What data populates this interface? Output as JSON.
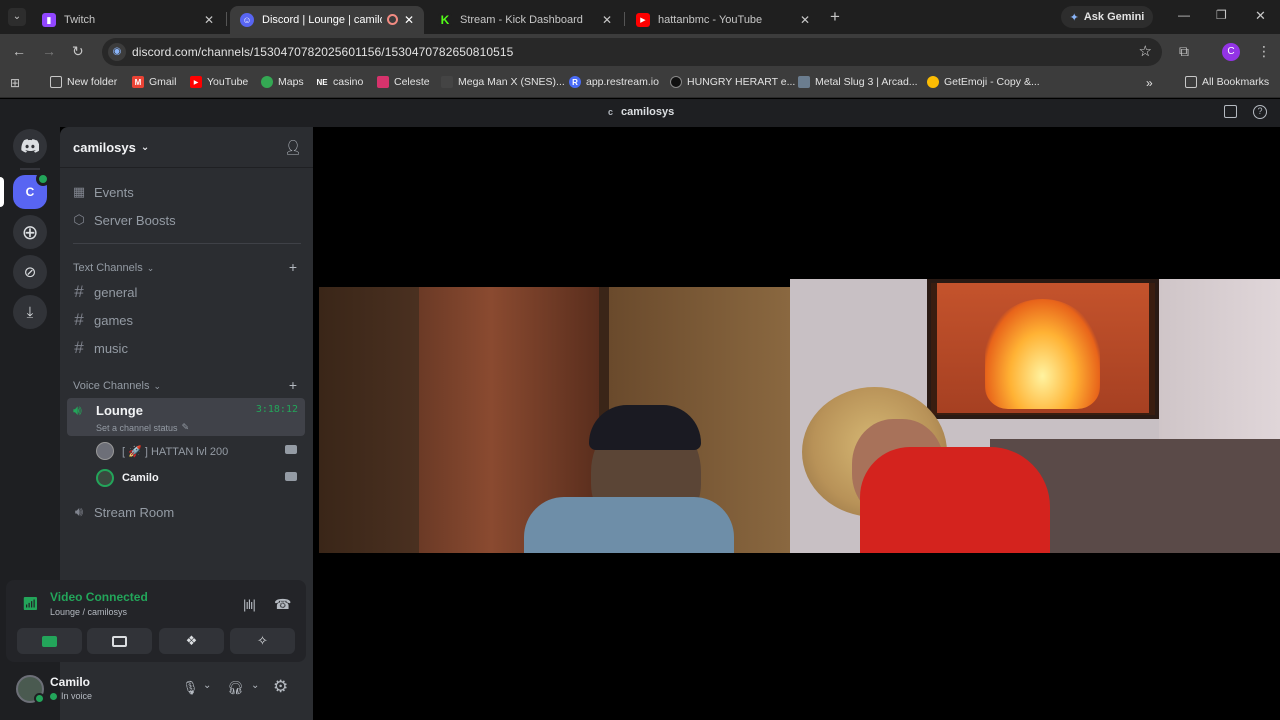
{
  "browser": {
    "tabs": [
      {
        "label": "Twitch",
        "favicon": "twitch-icon"
      },
      {
        "label": "Discord | Lounge | camilosy",
        "favicon": "discord-icon"
      },
      {
        "label": "Stream - Kick Dashboard",
        "favicon": "kick-icon"
      },
      {
        "label": "hattanbmc - YouTube",
        "favicon": "youtube-icon"
      }
    ],
    "ask_gemini": "Ask Gemini",
    "url": "discord.com/channels/1530470782025601156/1530470782650810515",
    "profile_initial": "C",
    "bookmarks": [
      "New folder",
      "Gmail",
      "YouTube",
      "Maps",
      "casino",
      "Celeste",
      "Mega Man X (SNES)...",
      "app.restream.io",
      "HUNGRY HERART e...",
      "Metal Slug 3 | Arcad...",
      "GetEmoji - Copy &..."
    ],
    "all_bookmarks": "All Bookmarks",
    "bookmark_icon_letters": {
      "casino": "NE",
      "restream": "R"
    }
  },
  "discord": {
    "window_title": "camilosys",
    "window_title_icon": "c",
    "server_initial": "C",
    "server_name": "camilosys",
    "menu": [
      "Events",
      "Server Boosts"
    ],
    "text_category": "Text Channels",
    "text_channels": [
      "general",
      "games",
      "music"
    ],
    "voice_category": "Voice Channels",
    "voice_channel": {
      "name": "Lounge",
      "timer": "3:18:12",
      "status_placeholder": "Set a channel status",
      "members": [
        "[ 🚀 ] HATTAN lvl 200",
        "Camilo"
      ]
    },
    "other_voice_channel": "Stream Room",
    "connection": {
      "status": "Video Connected",
      "location": "Lounge / camilosys"
    },
    "user": {
      "name": "Camilo",
      "status": "In voice"
    },
    "colors": {
      "accent": "#5865f2",
      "green": "#23a55a",
      "connected": "#3ba55d"
    }
  }
}
